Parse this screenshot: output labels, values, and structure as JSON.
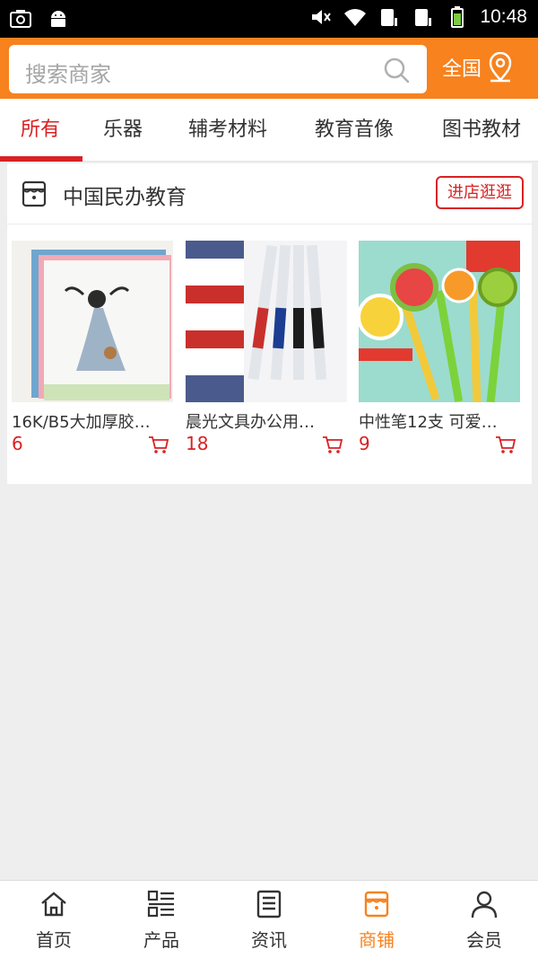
{
  "status_bar": {
    "time": "10:48"
  },
  "header": {
    "search_placeholder": "搜索商家",
    "region": "全国"
  },
  "tabs": [
    {
      "label": "所有",
      "active": true
    },
    {
      "label": "乐器"
    },
    {
      "label": "辅考材料"
    },
    {
      "label": "教育音像"
    },
    {
      "label": "图书教材"
    }
  ],
  "store": {
    "name": "中国民办教育",
    "visit_label": "进店逛逛",
    "products": [
      {
        "name": "16K/B5大加厚胶…",
        "price": "6"
      },
      {
        "name": "晨光文具办公用…",
        "price": "18"
      },
      {
        "name": "中性笔12支 可爱…",
        "price": "9"
      }
    ]
  },
  "bottom_nav": [
    {
      "label": "首页",
      "icon": "home-icon"
    },
    {
      "label": "产品",
      "icon": "grid-list-icon"
    },
    {
      "label": "资讯",
      "icon": "news-icon"
    },
    {
      "label": "商铺",
      "icon": "shop-icon",
      "active": true
    },
    {
      "label": "会员",
      "icon": "person-icon"
    }
  ],
  "colors": {
    "accent": "#f7821e",
    "red": "#d92123"
  }
}
